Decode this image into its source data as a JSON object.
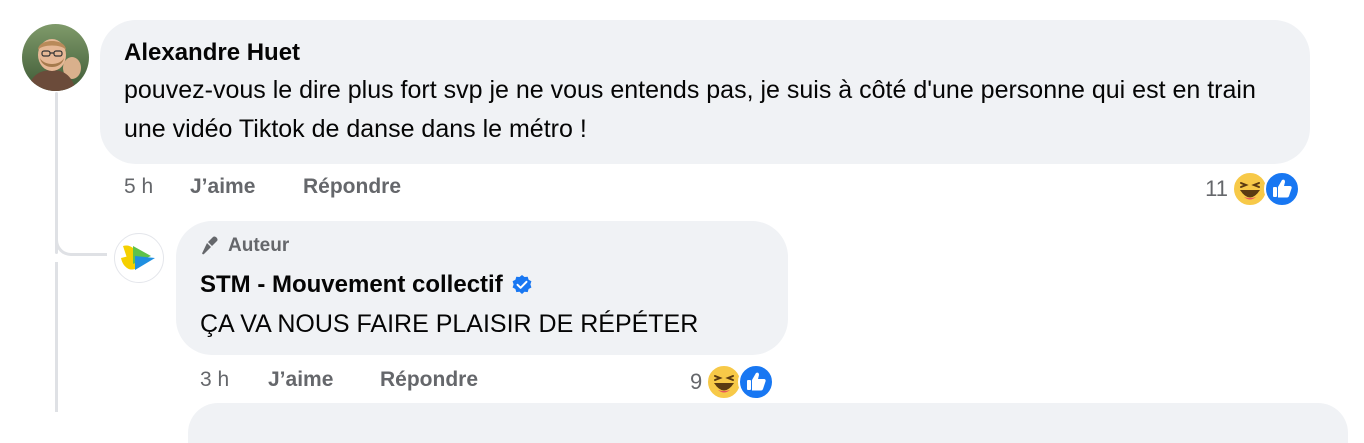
{
  "comment1": {
    "author": "Alexandre Huet",
    "text": "pouvez-vous le dire plus fort svp je ne vous entends pas, je suis à côté d'une personne qui est en train une vidéo Tiktok de danse dans le métro !",
    "time": "5 h",
    "like_label": "J’aime",
    "reply_label": "Répondre",
    "reaction_count": "11",
    "reactions": [
      "haha-icon",
      "like-icon"
    ]
  },
  "comment2": {
    "badge": "Auteur",
    "author": "STM - Mouvement collectif",
    "verified": true,
    "text": "ÇA VA NOUS FAIRE PLAISIR DE RÉPÉTER",
    "time": "3 h",
    "like_label": "J’aime",
    "reply_label": "Répondre",
    "reaction_count": "9",
    "reactions": [
      "haha-icon",
      "like-icon"
    ]
  },
  "colors": {
    "bubble": "#f0f2f5",
    "meta_text": "#65676b",
    "like_blue": "#1877f2",
    "verified_blue": "#1877f2",
    "stm_yellow": "#f5d000",
    "stm_green": "#5ec24a",
    "stm_blue": "#1f8fe0"
  }
}
